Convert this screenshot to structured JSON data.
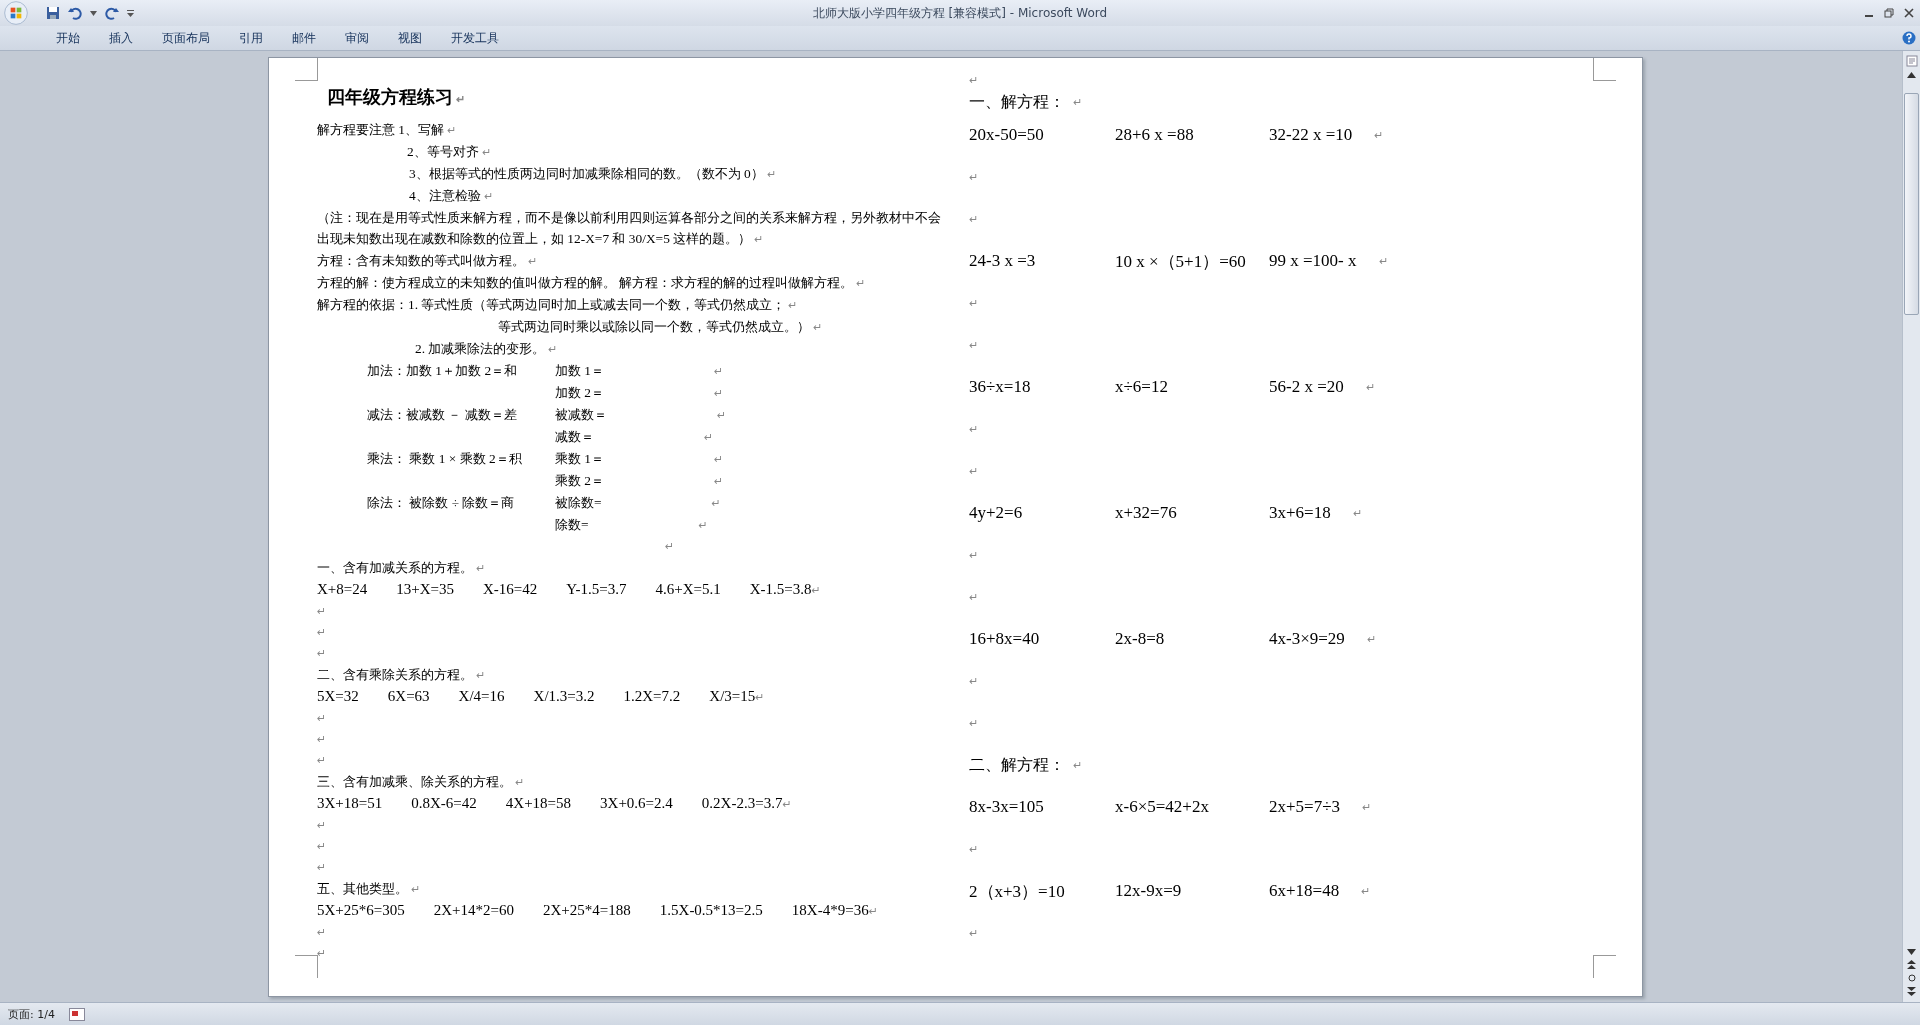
{
  "window": {
    "title": "北师大版小学四年级方程 [兼容模式] - Microsoft Word"
  },
  "ribbon_tabs": [
    {
      "label": "开始"
    },
    {
      "label": "插入"
    },
    {
      "label": "页面布局"
    },
    {
      "label": "引用"
    },
    {
      "label": "邮件"
    },
    {
      "label": "审阅"
    },
    {
      "label": "视图"
    },
    {
      "label": "开发工具"
    }
  ],
  "left_column": [
    {
      "kind": "title",
      "text": "四年级方程练习",
      "mark": "↵"
    },
    {
      "kind": "para",
      "text": "解方程要注意 1、写解",
      "mark": "↵"
    },
    {
      "kind": "indent",
      "text": "2、等号对齐",
      "mark": "↵"
    },
    {
      "kind": "indent",
      "text": "3、根据等式的性质两边同时加减乘除相同的数。（数不为 0）",
      "mark": "↵"
    },
    {
      "kind": "indent",
      "text": "4、注意检验",
      "mark": "↵"
    },
    {
      "kind": "para",
      "text": "（注：现在是用等式性质来解方程，而不是像以前利用四则运算各部分之间的关系来解方程，另外教材中不会出现未知数出现在减数和除数的位置上，如 12-X=7 和 30/X=5 这样的题。）",
      "mark": "↵"
    },
    {
      "kind": "para",
      "text": "方程：含有未知数的等式叫做方程。",
      "mark": "↵"
    },
    {
      "kind": "para",
      "text": "方程的解：使方程成立的未知数的值叫做方程的解。 解方程：求方程的解的过程叫做解方程。",
      "mark": "↵"
    },
    {
      "kind": "para",
      "text": "解方程的依据：1. 等式性质（等式两边同时加上或减去同一个数，等式仍然成立；",
      "mark": "↵"
    },
    {
      "kind": "cont",
      "text": "等式两边同时乘以或除以同一个数，等式仍然成立。）",
      "mark": "↵"
    },
    {
      "kind": "indent",
      "text": "2. 加减乘除法的变形。",
      "mark": "↵"
    },
    {
      "kind": "rule",
      "left": "加法：加数 1＋加数 2＝和",
      "right": "加数 1＝",
      "mark": "↵"
    },
    {
      "kind": "rule",
      "right": "加数 2＝",
      "mark": "↵"
    },
    {
      "kind": "rule",
      "left": "减法：被减数 － 减数＝差",
      "right": "被减数＝",
      "mark": "↵"
    },
    {
      "kind": "rule",
      "right": "减数＝",
      "mark": "↵"
    },
    {
      "kind": "rule",
      "left": "乘法： 乘数 1 × 乘数 2＝积",
      "right": "乘数 1＝",
      "mark": "↵"
    },
    {
      "kind": "rule",
      "right": "乘数 2＝",
      "mark": "↵"
    },
    {
      "kind": "rule",
      "left": "除法： 被除数 ÷ 除数＝商",
      "right": "被除数=",
      "mark": "↵"
    },
    {
      "kind": "rule",
      "right": "除数=",
      "mark": "↵"
    },
    {
      "kind": "rule",
      "mark": "↵"
    },
    {
      "kind": "para",
      "text": "一、含有加减关系的方程。",
      "mark": "↵"
    },
    {
      "kind": "eqs",
      "items": [
        "X+8=24",
        "13+X=35",
        "X-16=42",
        "Y-1.5=3.7",
        "4.6+X=5.1",
        "X-1.5=3.8"
      ],
      "mark": "↵"
    },
    {
      "kind": "blank",
      "mark": "↵"
    },
    {
      "kind": "blank",
      "mark": "↵"
    },
    {
      "kind": "blank",
      "mark": "↵"
    },
    {
      "kind": "para",
      "text": "二、含有乘除关系的方程。",
      "mark": "↵"
    },
    {
      "kind": "eqs",
      "items": [
        "5X=32",
        "6X=63",
        "X/4=16",
        "X/1.3=3.2",
        "1.2X=7.2",
        "X/3=15"
      ],
      "mark": "↵"
    },
    {
      "kind": "blank",
      "mark": "↵"
    },
    {
      "kind": "blank",
      "mark": "↵"
    },
    {
      "kind": "blank",
      "mark": "↵"
    },
    {
      "kind": "para",
      "text": "三、含有加减乘、除关系的方程。",
      "mark": "↵"
    },
    {
      "kind": "eqs",
      "items": [
        "3X+18=51",
        "0.8X-6=42",
        "4X+18=58",
        "3X+0.6=2.4",
        "0.2X-2.3=3.7"
      ],
      "mark": "↵"
    },
    {
      "kind": "blank",
      "mark": "↵"
    },
    {
      "kind": "blank",
      "mark": "↵"
    },
    {
      "kind": "blank",
      "mark": "↵"
    },
    {
      "kind": "para",
      "text": "五、其他类型。",
      "mark": "↵"
    },
    {
      "kind": "eqs",
      "items": [
        "5X+25*6=305",
        "2X+14*2=60",
        "2X+25*4=188",
        "1.5X-0.5*13=2.5",
        "18X-4*9=36"
      ],
      "mark": "↵"
    },
    {
      "kind": "blank",
      "mark": "↵"
    },
    {
      "kind": "blank",
      "mark": "↵"
    }
  ],
  "right_column": [
    {
      "kind": "gap",
      "mark": "↵"
    },
    {
      "kind": "heading",
      "text": "一、解方程：",
      "mark": "↵"
    },
    {
      "kind": "eqs",
      "items": [
        "20x-50=50",
        "28+6 x =88",
        "32-22 x =10"
      ],
      "mark": "↵"
    },
    {
      "kind": "blank",
      "mark": "↵"
    },
    {
      "kind": "blank",
      "mark": "↵"
    },
    {
      "kind": "eqs",
      "items": [
        "24-3 x =3",
        "10 x ×（5+1）=60",
        "99 x =100- x"
      ],
      "mark": "↵"
    },
    {
      "kind": "blank",
      "mark": "↵"
    },
    {
      "kind": "blank",
      "mark": "↵"
    },
    {
      "kind": "eqs",
      "items": [
        "36÷x=18",
        "x÷6=12",
        "56-2 x =20"
      ],
      "mark": "↵"
    },
    {
      "kind": "blank",
      "mark": "↵"
    },
    {
      "kind": "blank",
      "mark": "↵"
    },
    {
      "kind": "eqs",
      "items": [
        "4y+2=6",
        "x+32=76",
        "3x+6=18"
      ],
      "mark": "↵"
    },
    {
      "kind": "blank",
      "mark": "↵"
    },
    {
      "kind": "blank",
      "mark": "↵"
    },
    {
      "kind": "eqs",
      "items": [
        "16+8x=40",
        "2x-8=8",
        "4x-3×9=29"
      ],
      "mark": "↵"
    },
    {
      "kind": "blank",
      "mark": "↵"
    },
    {
      "kind": "blank",
      "mark": "↵"
    },
    {
      "kind": "section",
      "text": "二、解方程：",
      "mark": "↵"
    },
    {
      "kind": "eqs",
      "items": [
        "8x-3x=105",
        "x-6×5=42+2x",
        "2x+5=7÷3"
      ],
      "mark": "↵"
    },
    {
      "kind": "blank",
      "mark": "↵"
    },
    {
      "kind": "eqs",
      "items": [
        "2（x+3）=10",
        "12x-9x=9",
        "6x+18=48"
      ],
      "mark": "↵"
    },
    {
      "kind": "blank",
      "mark": "↵"
    }
  ],
  "status_bar": {
    "page": "页面: 1/4"
  }
}
